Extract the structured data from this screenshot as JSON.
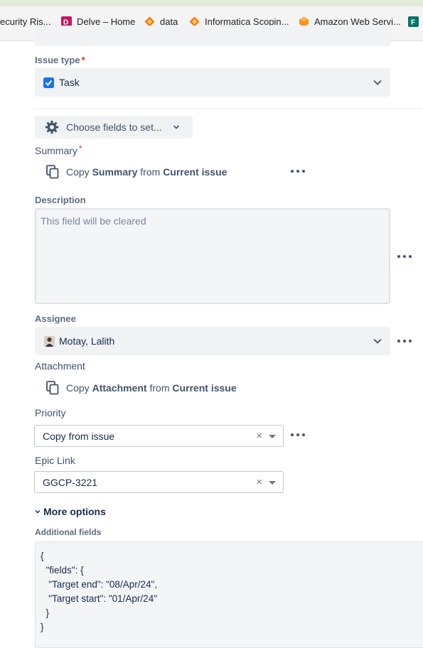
{
  "bookmarks": [
    {
      "label": "ecurity Ris...",
      "icon": "generic-icon"
    },
    {
      "label": "Delve – Home",
      "icon": "delve-icon",
      "color": "#c2185b"
    },
    {
      "label": "data",
      "icon": "diamond-icon",
      "color": "#f57c00"
    },
    {
      "label": "Informatica Scopin...",
      "icon": "diamond-icon",
      "color": "#f57c00"
    },
    {
      "label": "Amazon Web Servi...",
      "icon": "aws-cube-icon",
      "color": "#f7931e"
    },
    {
      "label": "",
      "icon": "forms-icon",
      "color": "#077568"
    }
  ],
  "issue_type": {
    "label": "Issue type",
    "required_mark": "*",
    "value": "Task"
  },
  "choose_fields": {
    "label": "Choose fields to set..."
  },
  "summary": {
    "label": "Summary",
    "required_mark": "*",
    "copy_prefix": "Copy",
    "field": "Summary",
    "from": "from",
    "source": "Current issue"
  },
  "description": {
    "label": "Description",
    "placeholder": "This field will be cleared"
  },
  "assignee": {
    "label": "Assignee",
    "value": "Motay, Lalith"
  },
  "attachment": {
    "label": "Attachment",
    "copy_prefix": "Copy",
    "field": "Attachment",
    "from": "from",
    "source": "Current issue"
  },
  "priority": {
    "label": "Priority",
    "value": "Copy from issue",
    "clear": "×"
  },
  "epic_link": {
    "label": "Epic Link",
    "value": "GGCP-3221",
    "clear": "×"
  },
  "more_options": {
    "label": "More options"
  },
  "additional_fields": {
    "label": "Additional fields",
    "lines": [
      "{",
      "  \"fields\": {",
      "   \"Target end\": \"08/Apr/24\",",
      "   \"Target start\": \"01/Apr/24\"",
      "  }",
      "}"
    ]
  },
  "colors": {
    "accent": "#0052cc",
    "required": "#de350b",
    "text": "#172b4d",
    "muted": "#5e6c84"
  }
}
